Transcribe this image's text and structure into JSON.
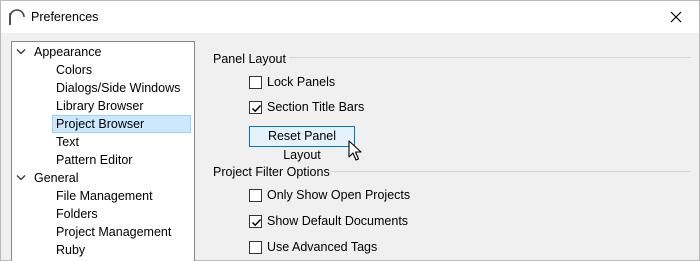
{
  "window": {
    "title": "Preferences",
    "close_glyph": "×",
    "app_icon": "arch-logo-icon"
  },
  "tree": {
    "categories": [
      {
        "label": "Appearance",
        "expanded": true,
        "children": [
          "Colors",
          "Dialogs/Side Windows",
          "Library Browser",
          "Project Browser",
          "Text",
          "Pattern Editor"
        ]
      },
      {
        "label": "General",
        "expanded": true,
        "children": [
          "File Management",
          "Folders",
          "Project Management",
          "Ruby"
        ]
      }
    ],
    "selected": "Project Browser"
  },
  "panel_layout": {
    "title": "Panel Layout",
    "lock_panels": {
      "label": "Lock Panels",
      "checked": false
    },
    "section_title_bars": {
      "label": "Section Title Bars",
      "checked": true
    },
    "reset_button": "Reset Panel Layout"
  },
  "project_filter": {
    "title": "Project Filter Options",
    "only_show_open": {
      "label": "Only Show Open Projects",
      "checked": false
    },
    "show_default_docs": {
      "label": "Show Default Documents",
      "checked": true
    },
    "use_advanced_tags": {
      "label": "Use Advanced Tags",
      "checked": false
    }
  },
  "colors": {
    "selection_bg": "#cce8ff",
    "selection_border": "#99d1ff",
    "button_focus_border": "#0078d7",
    "button_hover_bg": "#e5f1fb"
  }
}
